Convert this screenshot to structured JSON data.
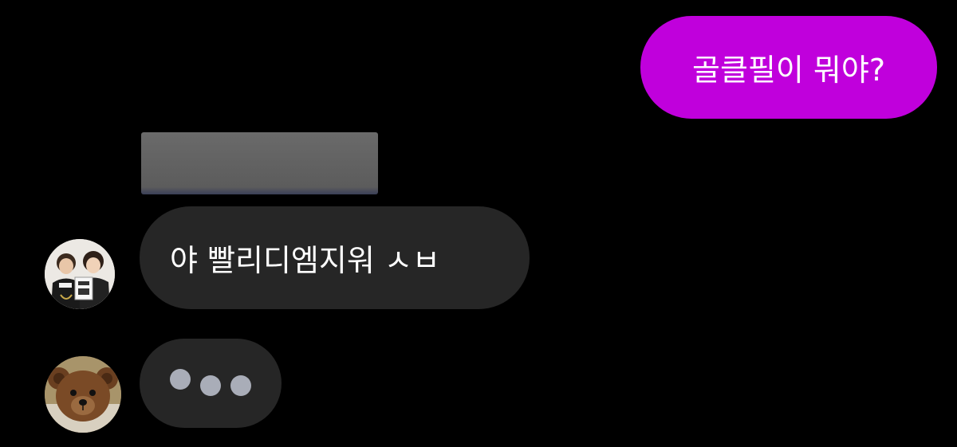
{
  "messages": {
    "sent": {
      "text": "골클필이 뭐야?",
      "bubble_color": "#c000dc"
    },
    "received": {
      "text": "야 빨리디엠지워 ㅅㅂ",
      "bubble_color": "#262626"
    },
    "typing_indicator": {
      "dot_color": "#a9adb8"
    }
  },
  "avatars": {
    "first": {
      "icon": "two-people-photo-icon"
    },
    "second": {
      "icon": "teddy-bear-photo-icon"
    }
  },
  "redaction": {
    "color": "#5e5e5e"
  },
  "theme": {
    "background": "#000000"
  }
}
